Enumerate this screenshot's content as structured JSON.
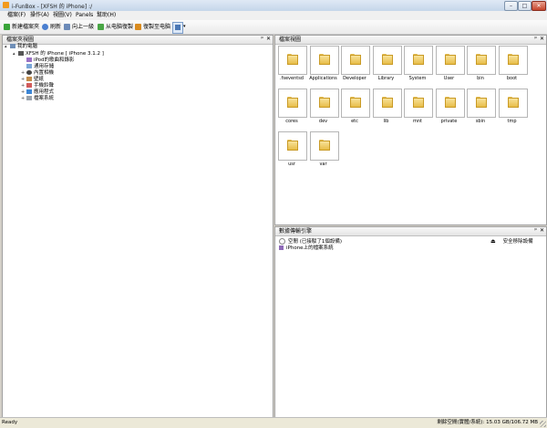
{
  "window": {
    "title": "i-FunBox - [XFSH 的 iPhone] :/",
    "controls": [
      "–",
      "□",
      "✕"
    ]
  },
  "menu": [
    "檔案(F)",
    "操作(A)",
    "視圖(V)",
    "Panels",
    "幫助(H)"
  ],
  "toolbar": {
    "new_folder": "新建檔案夾",
    "refresh": "刷新",
    "up": "向上一級",
    "copy_from_pc": "从电脑復製",
    "copy_to_pc": "復製至电脑"
  },
  "colors": {
    "accent": "#2a6fc9",
    "folder": "#e9c04e"
  },
  "tree_panel": {
    "title": "檔案夾視圖",
    "pin": "ᵖ",
    "close": "✕",
    "items": [
      {
        "label": "我的電腦",
        "icon": "computer-icon"
      },
      {
        "label": "XFSH 的 iPhone [ iPhone 3.1.2 ]",
        "icon": "phone-icon"
      },
      {
        "label": "iPod的歌曲和錄影",
        "icon": "music-icon"
      },
      {
        "label": "通用存儲",
        "icon": "storage-icon"
      },
      {
        "label": "內置相機",
        "icon": "camera-icon"
      },
      {
        "label": "壁紙",
        "icon": "wallpaper-icon"
      },
      {
        "label": "手機鈴聲",
        "icon": "ringtone-icon"
      },
      {
        "label": "應用程式",
        "icon": "apps-icon"
      },
      {
        "label": "檔案系統",
        "icon": "filesystem-icon"
      }
    ]
  },
  "file_panel": {
    "title": "檔案視圖",
    "pin": "ᵖ",
    "close": "✕",
    "folders": [
      ".fseventsd",
      "Applications",
      "Developer",
      "Library",
      "System",
      "User",
      "bin",
      "boot",
      "cores",
      "dev",
      "etc",
      "lib",
      "mnt",
      "private",
      "sbin",
      "tmp",
      "usr",
      "var"
    ]
  },
  "devices_panel": {
    "title": "數據傳輸引擎",
    "pin": "ᵖ",
    "close": "✕",
    "rows": [
      {
        "label": "空閒 (已接駁了1個設備)"
      },
      {
        "label": "iPhone上的檔案系統"
      }
    ],
    "safe_remove": "安全移除設備"
  },
  "status": {
    "left": "Ready",
    "right": "剩餘空間(實體/系統): 15.03 GB/106.72 MB"
  }
}
